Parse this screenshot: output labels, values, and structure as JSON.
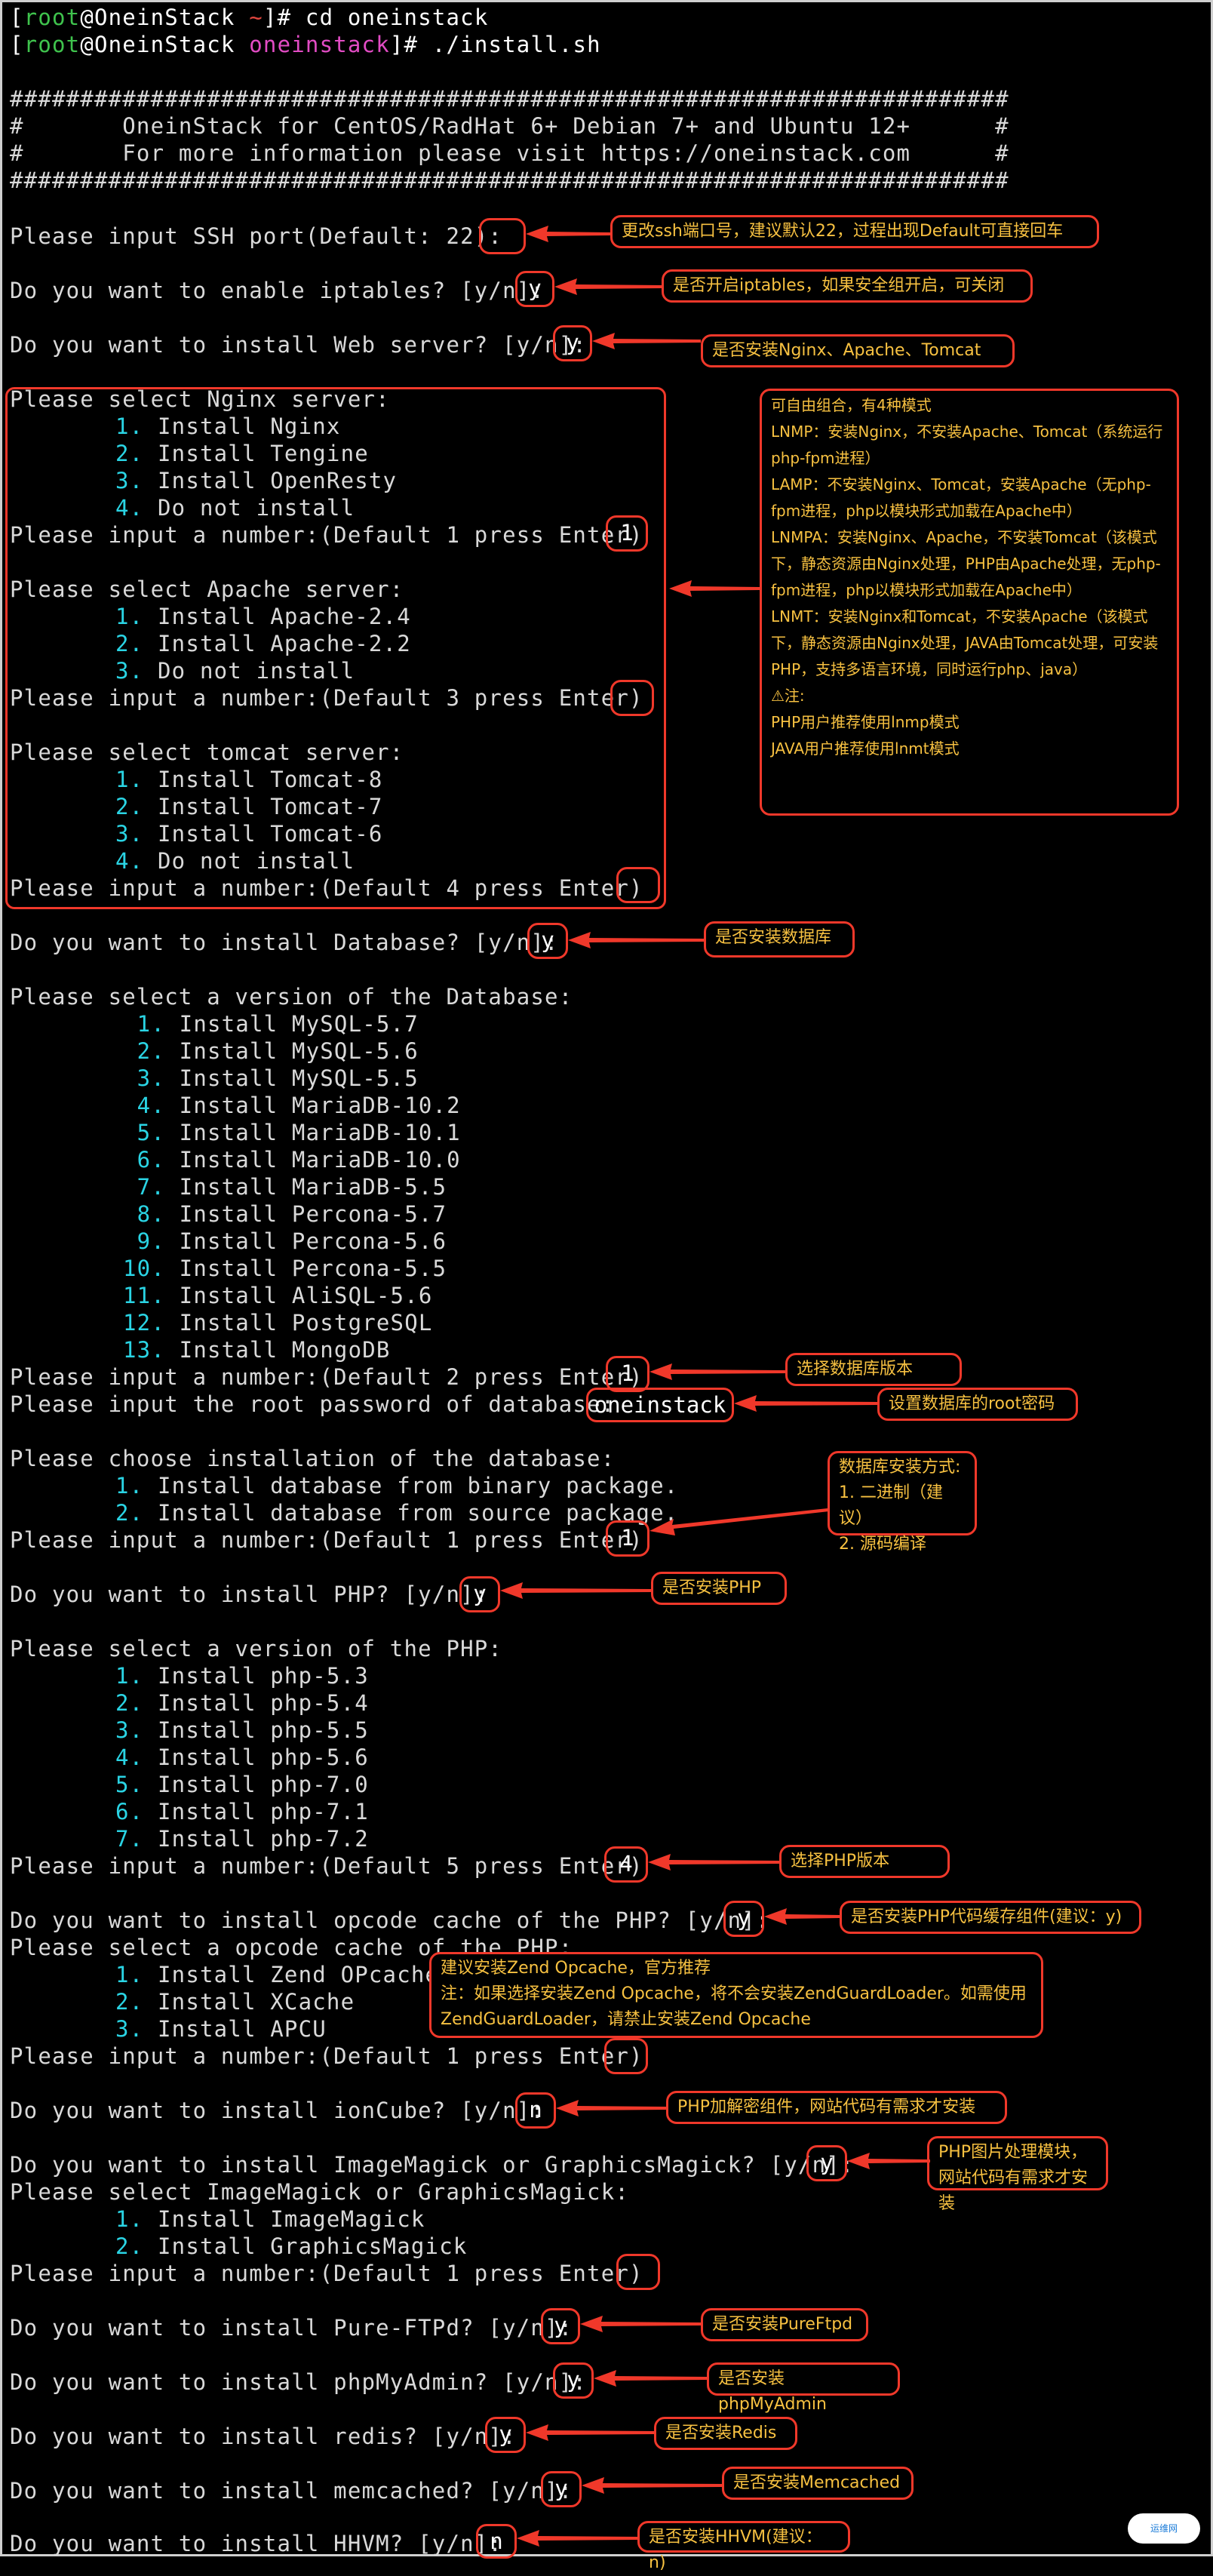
{
  "colors": {
    "prompt_green": "#3fc34d",
    "root_red": "#e0463f",
    "dir_pink": "#e24cc4",
    "num_cyan": "#2ad4e4",
    "annotation_red": "#f0382a",
    "note_text": "#f7c141"
  },
  "prompt": {
    "open": "[",
    "user": "root",
    "at": "@",
    "host": "OneinStack",
    "close_cmd1": "]# cd oneinstack",
    "home": "~",
    "dir": "oneinstack",
    "close_cmd2": "]# ./install.sh"
  },
  "banner": {
    "hashes": "#######################################################################",
    "line1": "#       OneinStack for CentOS/RadHat 6+ Debian 7+ and Ubuntu 12+      #",
    "line2": "#       For more information please visit https://oneinstack.com      #"
  },
  "q": {
    "ssh": "Please input SSH port(Default: 22):",
    "iptables": "Do you want to enable iptables? [y/n]:",
    "web": "Do you want to install Web server? [y/n]:",
    "nginx_title": "Please select Nginx server:",
    "nginx_opts": [
      "Install Nginx",
      "Install Tengine",
      "Install OpenResty",
      "Do not install"
    ],
    "nginx_input": "Please input a number:(Default 1 press Enter)",
    "apache_title": "Please select Apache server:",
    "apache_opts": [
      "Install Apache-2.4",
      "Install Apache-2.2",
      "Do not install"
    ],
    "apache_input": "Please input a number:(Default 3 press Enter)",
    "tomcat_title": "Please select tomcat server:",
    "tomcat_opts": [
      "Install Tomcat-8",
      "Install Tomcat-7",
      "Install Tomcat-6",
      "Do not install"
    ],
    "tomcat_input": "Please input a number:(Default 4 press Enter)",
    "db": "Do you want to install Database? [y/n]:",
    "db_title": "Please select a version of the Database:",
    "db_opts": [
      "Install MySQL-5.7",
      "Install MySQL-5.6",
      "Install MySQL-5.5",
      "Install MariaDB-10.2",
      "Install MariaDB-10.1",
      "Install MariaDB-10.0",
      "Install MariaDB-5.5",
      "Install Percona-5.7",
      "Install Percona-5.6",
      "Install Percona-5.5",
      "Install AliSQL-5.6",
      "Install PostgreSQL",
      "Install MongoDB"
    ],
    "db_input": "Please input a number:(Default 2 press Enter)",
    "db_pass": "Please input the root password of database:",
    "db_method_title": "Please choose installation of the database:",
    "db_method_opts": [
      "Install database from binary package.",
      "Install database from source package."
    ],
    "db_method_input": "Please input a number:(Default 1 press Enter)",
    "php": "Do you want to install PHP? [y/n]:",
    "php_title": "Please select a version of the PHP:",
    "php_opts": [
      "Install php-5.3",
      "Install php-5.4",
      "Install php-5.5",
      "Install php-5.6",
      "Install php-7.0",
      "Install php-7.1",
      "Install php-7.2"
    ],
    "php_input": "Please input a number:(Default 5 press Enter)",
    "opcode": "Do you want to install opcode cache of the PHP? [y/n]:",
    "opcode_title": "Please select a opcode cache of the PHP:",
    "opcode_opts": [
      "Install Zend OPcache",
      "Install XCache",
      "Install APCU"
    ],
    "opcode_input": "Please input a number:(Default 1 press Enter)",
    "ioncube": "Do you want to install ionCube? [y/n]:",
    "imagick": "Do you want to install ImageMagick or GraphicsMagick? [y/n]:",
    "imagick_title": "Please select ImageMagick or GraphicsMagick:",
    "imagick_opts": [
      "Install ImageMagick",
      "Install GraphicsMagick"
    ],
    "imagick_input": "Please input a number:(Default 1 press Enter)",
    "ftp": "Do you want to install Pure-FTPd? [y/n]:",
    "pma": "Do you want to install phpMyAdmin? [y/n]:",
    "redis": "Do you want to install redis? [y/n]:",
    "memcached": "Do you want to install memcached? [y/n]:",
    "hhvm": "Do you want to install HHVM? [y/n]:"
  },
  "answers": {
    "ssh": "",
    "iptables": "y",
    "web": "y",
    "nginx": "1",
    "apache": "",
    "tomcat": "",
    "db": "y",
    "db_version": "1",
    "db_pass": "oneinstack",
    "db_method": "1",
    "php": "y",
    "php_version": "4",
    "opcode": "y",
    "opcode_num": "",
    "ioncube": "n",
    "imagick": "y",
    "imagick_num": "",
    "ftp": "y",
    "pma": "y",
    "redis": "y",
    "memcached": "y",
    "hhvm": "n"
  },
  "notes": {
    "ssh": "更改ssh端口号，建议默认22，过程出现Default可直接回车",
    "iptables": "是否开启iptables，如果安全组开启，可关闭",
    "web": "是否安装Nginx、Apache、Tomcat",
    "combo": "可自由组合，有4种模式\nLNMP：安装Nginx，不安装Apache、Tomcat（系统运行php-fpm进程）\nLAMP：不安装Nginx、Tomcat，安装Apache（无php-fpm进程，php以模块形式加载在Apache中）\nLNMPA：安装Nginx、Apache，不安装Tomcat（该模式下，静态资源由Nginx处理，PHP由Apache处理，无php-fpm进程，php以模块形式加载在Apache中）\nLNMT：安装Nginx和Tomcat，不安装Apache（该模式下，静态资源由Nginx处理，JAVA由Tomcat处理，可安装PHP，支持多语言环境，同时运行php、java）\n⚠注:\n  PHP用户推荐使用lnmp模式\n  JAVA用户推荐使用lnmt模式",
    "db": "是否安装数据库",
    "db_version": "选择数据库版本",
    "db_pass": "设置数据库的root密码",
    "db_method": "数据库安装方式:\n1. 二进制（建议）\n2. 源码编译",
    "php": "是否安装PHP",
    "php_version": "选择PHP版本",
    "opcode": "是否安装PHP代码缓存组件(建议：y)",
    "opcode_select": "建议安装Zend Opcache，官方推荐\n注：如果选择安装Zend Opcache，将不会安装ZendGuardLoader。如需使用ZendGuardLoader，请禁止安装Zend Opcache",
    "ioncube": "PHP加解密组件，网站代码有需求才安装",
    "imagick": "PHP图片处理模块，\n网站代码有需求才安装",
    "ftp": "是否安装PureFtpd",
    "pma": "是否安装phpMyAdmin",
    "redis": "是否安装Redis",
    "memcached": "是否安装Memcached",
    "hhvm": "是否安装HHVM(建议：n)"
  },
  "watermark": "运维网"
}
